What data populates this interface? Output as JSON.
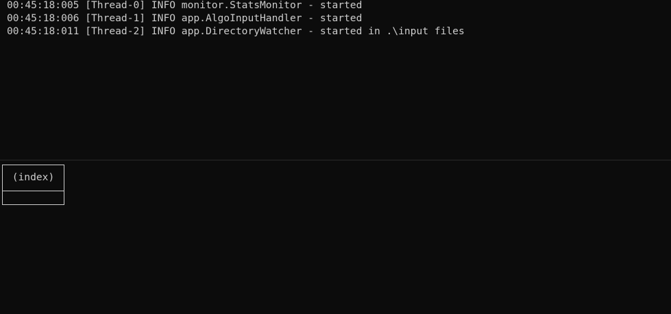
{
  "console": {
    "log_lines": [
      "00:45:18:005 [Thread-0] INFO monitor.StatsMonitor - started",
      "00:45:18:006 [Thread-1] INFO app.AlgoInputHandler - started",
      "00:45:18:011 [Thread-2] INFO app.DirectoryWatcher - started in .\\input files"
    ]
  },
  "table": {
    "header": "(index)",
    "rows": []
  },
  "colors": {
    "background": "#0c0c0c",
    "foreground": "#cccccc"
  }
}
